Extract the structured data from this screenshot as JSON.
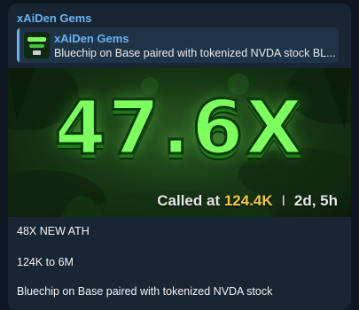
{
  "message": {
    "sender": "xAiDen Gems",
    "reply": {
      "title": "xAiDen Gems",
      "text": "Bluechip on Base paired with tokenized NVDA stock  BL..."
    },
    "media": {
      "multiplier": "47.6X",
      "called_prefix": "Called at",
      "called_value": "124.4K",
      "separator": "I",
      "duration": "2d, 5h",
      "accent_color": "#7dff5f",
      "value_color": "#f5c842"
    },
    "lines": [
      "48X NEW ATH",
      "124K to 6M",
      "Bluechip on Base paired with tokenized NVDA stock"
    ]
  },
  "colors": {
    "background": "#0e1621",
    "bubble": "#182533",
    "link": "#6ab3f3"
  }
}
